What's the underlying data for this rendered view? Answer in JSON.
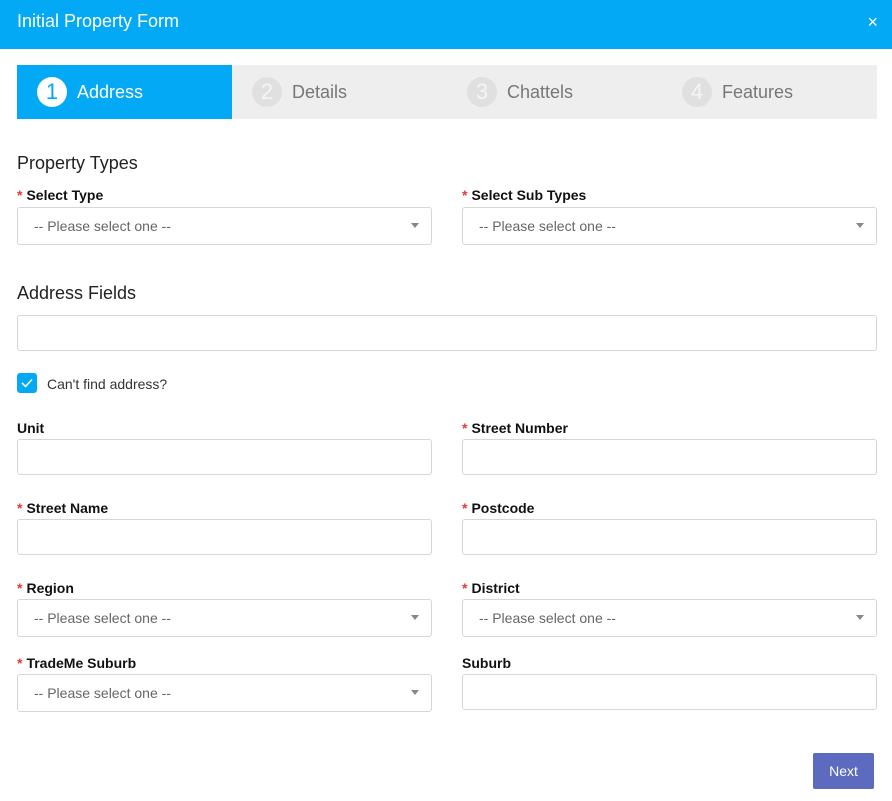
{
  "header": {
    "title": "Initial Property Form",
    "close_label": "×"
  },
  "stepper": {
    "steps": [
      {
        "number": "1",
        "label": "Address"
      },
      {
        "number": "2",
        "label": "Details"
      },
      {
        "number": "3",
        "label": "Chattels"
      },
      {
        "number": "4",
        "label": "Features"
      }
    ]
  },
  "property_types": {
    "title": "Property Types",
    "select_type": {
      "required": "*",
      "label": "Select Type",
      "value": "-- Please select one --"
    },
    "select_sub_types": {
      "required": "*",
      "label": "Select Sub Types",
      "value": "-- Please select one --"
    }
  },
  "address_fields": {
    "title": "Address Fields",
    "search_value": "",
    "cant_find": {
      "label": "Can't find address?",
      "checked": true
    }
  },
  "fields": {
    "unit": {
      "label": "Unit",
      "value": ""
    },
    "street_number": {
      "required": "*",
      "label": "Street Number",
      "value": ""
    },
    "street_name": {
      "required": "*",
      "label": "Street Name",
      "value": ""
    },
    "postcode": {
      "required": "*",
      "label": "Postcode",
      "value": ""
    },
    "region": {
      "required": "*",
      "label": "Region",
      "value": "-- Please select one --"
    },
    "district": {
      "required": "*",
      "label": "District",
      "value": "-- Please select one --"
    },
    "trademe_suburb": {
      "required": "*",
      "label": "TradeMe Suburb",
      "value": "-- Please select one --"
    },
    "suburb": {
      "label": "Suburb",
      "value": ""
    }
  },
  "footer": {
    "next_label": "Next"
  },
  "colors": {
    "primary": "#03a9f4",
    "button": "#5c6bc0",
    "required": "#e53935"
  }
}
